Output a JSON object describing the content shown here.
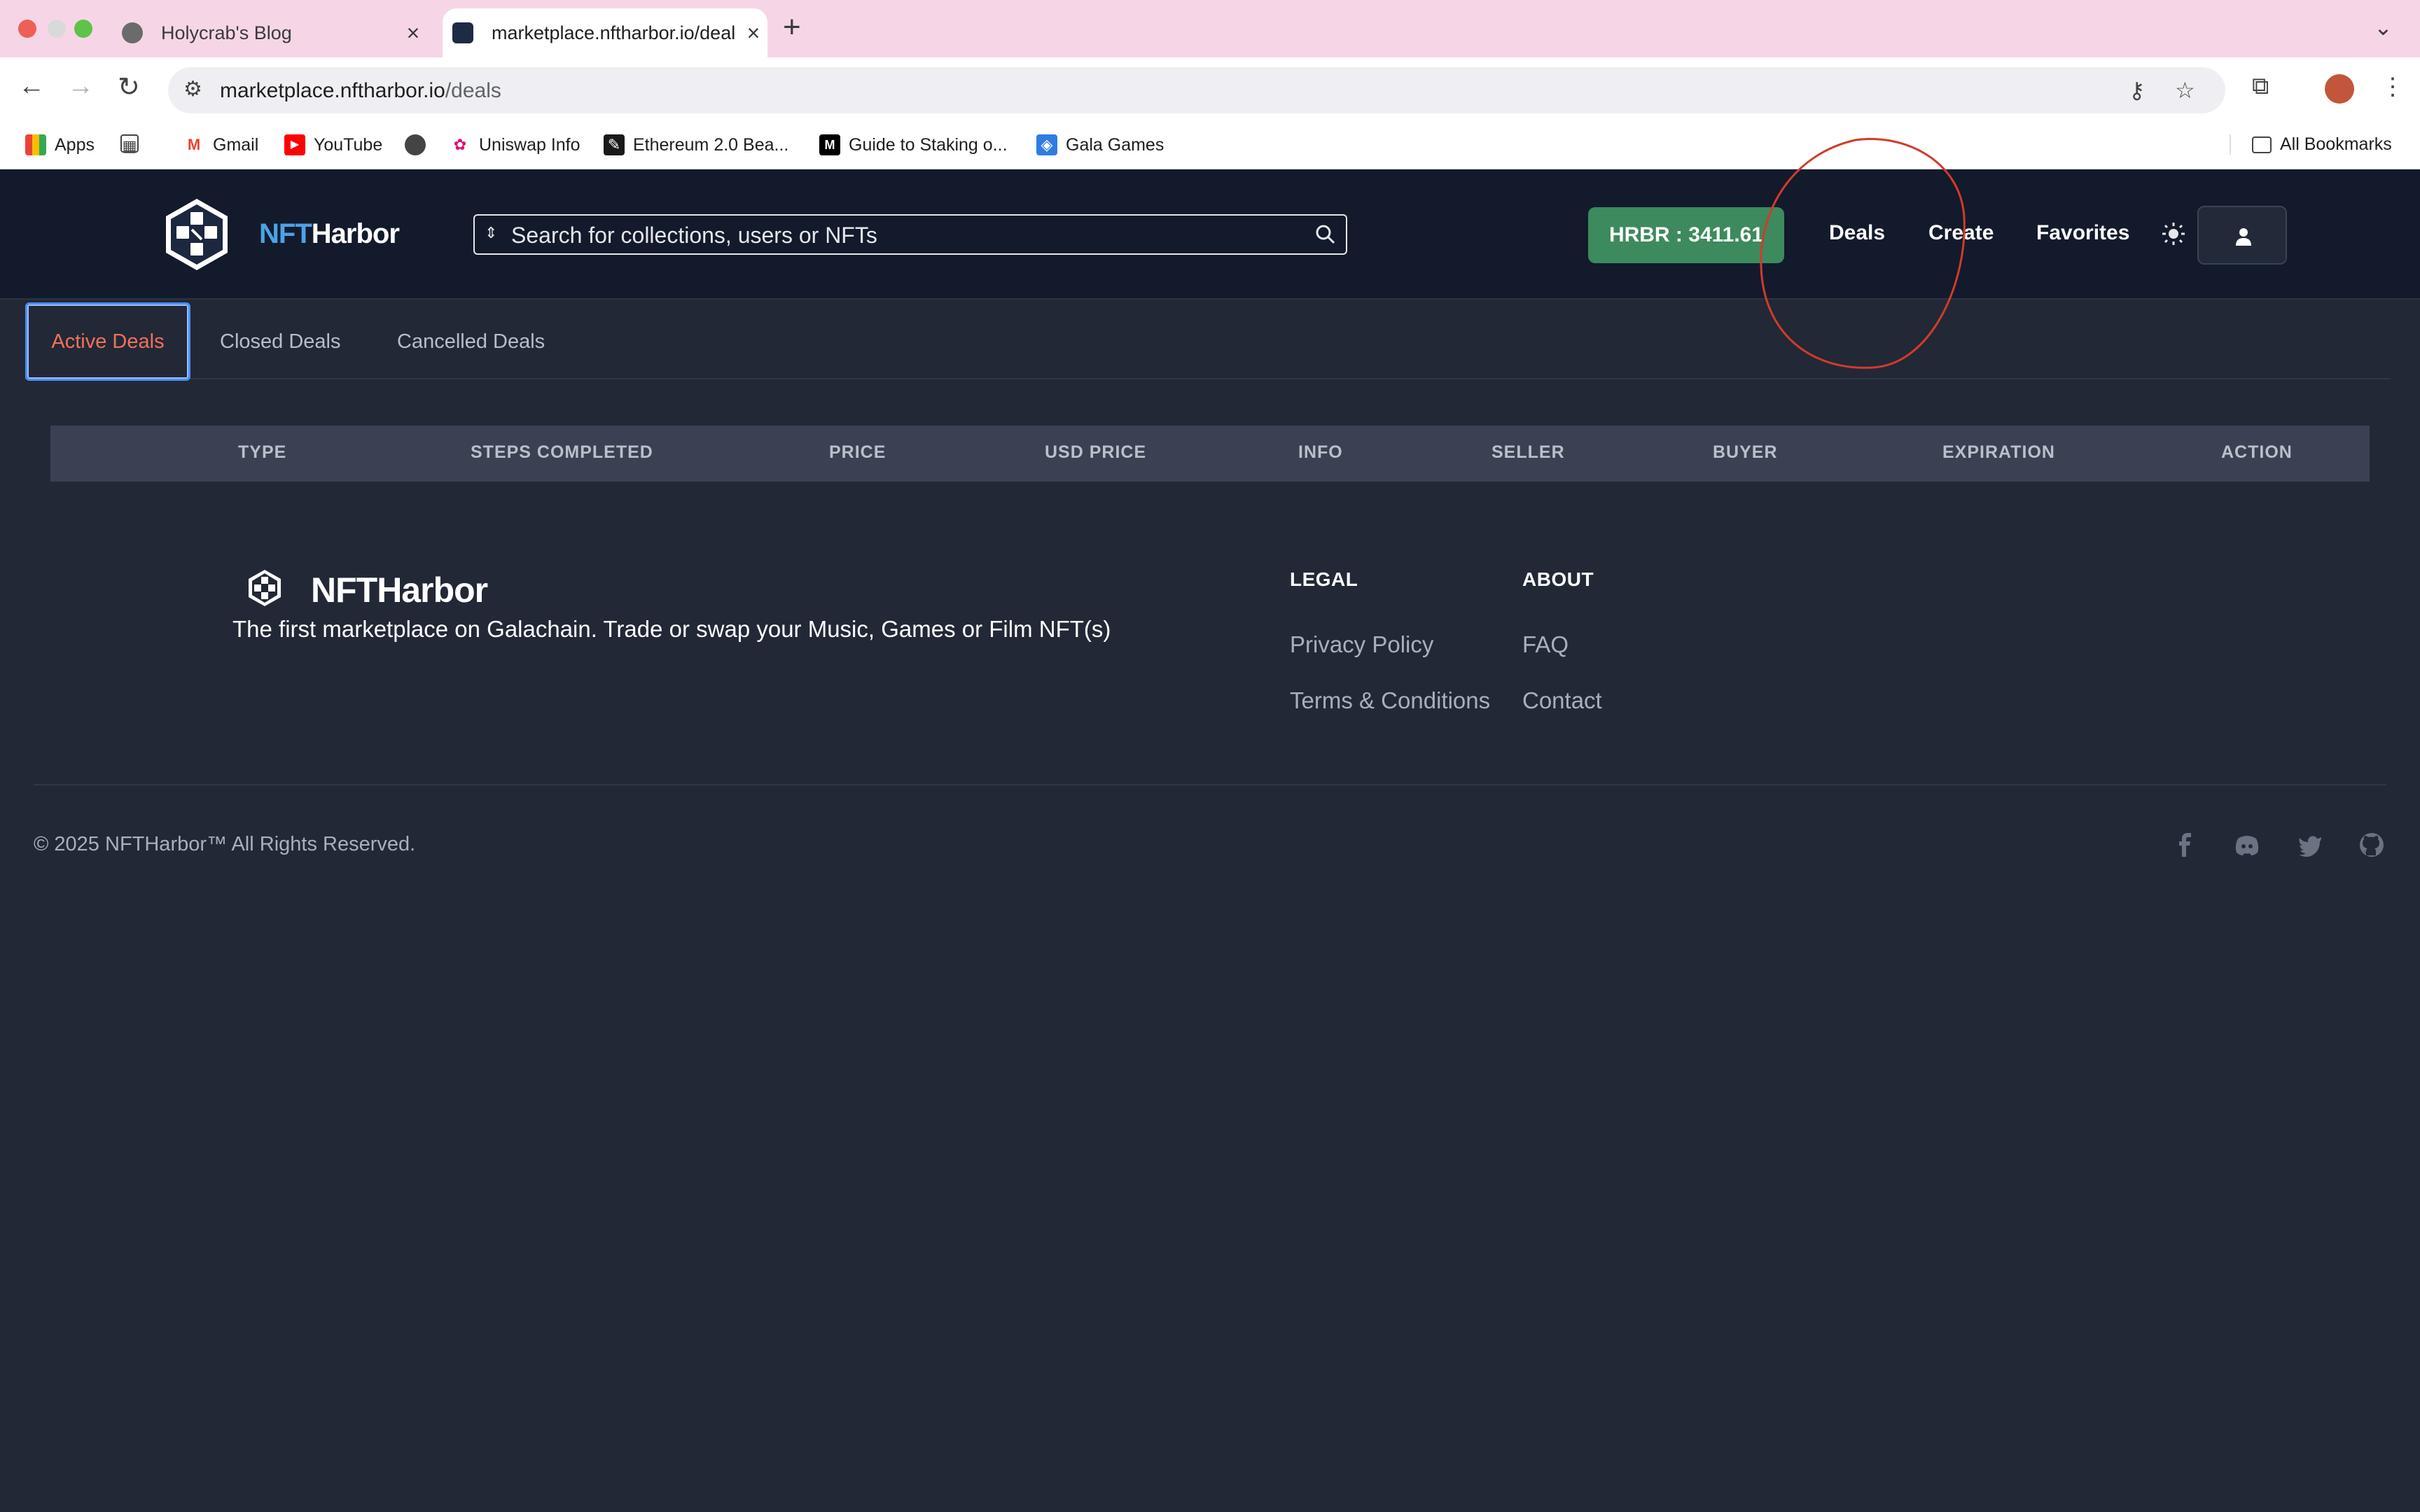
{
  "browser": {
    "tabs": [
      {
        "title": "Holycrab's Blog",
        "active": false
      },
      {
        "title": "marketplace.nftharbor.io/deal",
        "active": true
      }
    ],
    "url_host": "marketplace.nftharbor.io",
    "url_path": "/deals",
    "bookmarks": [
      {
        "label": "Apps",
        "icon": "apps-grid-icon"
      },
      {
        "label": "Gmail",
        "icon": "gmail-icon"
      },
      {
        "label": "YouTube",
        "icon": "youtube-icon"
      },
      {
        "label": "Uniswap Info",
        "icon": "uniswap-icon"
      },
      {
        "label": "Ethereum 2.0 Bea...",
        "icon": "ethereum-icon"
      },
      {
        "label": "Guide to Staking o...",
        "icon": "medium-icon"
      },
      {
        "label": "Gala Games",
        "icon": "gala-icon"
      }
    ],
    "all_bookmarks": "All Bookmarks"
  },
  "site": {
    "brand_prefix": "NFT",
    "brand_suffix": "Harbor",
    "search_placeholder": "Search for collections, users or NFTs",
    "balance": "HRBR : 3411.61",
    "nav": {
      "deals": "Deals",
      "create": "Create",
      "favorites": "Favorites"
    }
  },
  "deal_tabs": [
    "Active Deals",
    "Closed Deals",
    "Cancelled Deals"
  ],
  "table": {
    "columns": [
      "TYPE",
      "STEPS COMPLETED",
      "PRICE",
      "USD PRICE",
      "INFO",
      "SELLER",
      "BUYER",
      "EXPIRATION",
      "ACTION"
    ],
    "rows": []
  },
  "footer": {
    "brand": "NFTHarbor",
    "tagline": "The first marketplace on Galachain. Trade or swap your Music, Games or Film NFT(s)",
    "legal": {
      "heading": "LEGAL",
      "links": [
        "Privacy Policy",
        "Terms & Conditions"
      ]
    },
    "about": {
      "heading": "ABOUT",
      "links": [
        "FAQ",
        "Contact"
      ]
    },
    "copyright": "© 2025 NFTHarbor™ All Rights Reserved.",
    "social": [
      "facebook-icon",
      "discord-icon",
      "twitter-icon",
      "github-icon"
    ]
  },
  "colors": {
    "page_bg": "#222836",
    "header_bg": "#131a2b",
    "balance_green": "#3c8a5d",
    "active_tab_text": "#f0725a",
    "brand_blue": "#4aa3e8",
    "annotation_red": "#d23b2a"
  }
}
